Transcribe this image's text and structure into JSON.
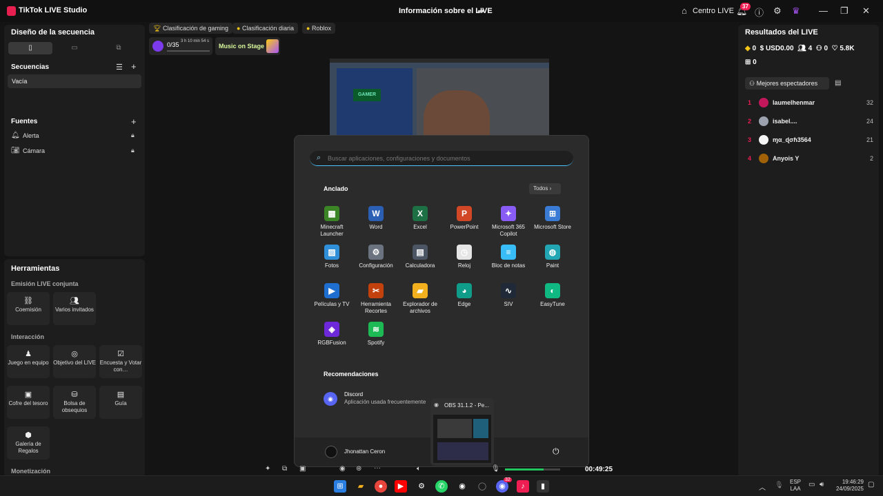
{
  "titlebar": {
    "app_name": "TikTok LIVE Studio",
    "center_title": "Información sobre el LIVE",
    "centro_label": "Centro LIVE",
    "notif_count": "37"
  },
  "left": {
    "design_title": "Diseño de la secuencia",
    "sequences_title": "Secuencias",
    "sequence_item": "Vacía",
    "sources_title": "Fuentes",
    "sources": [
      "Alerta",
      "Cámara"
    ],
    "tools_title": "Herramientas",
    "joint_title": "Emisión LIVE conjunta",
    "joint_tools": [
      "Coemisión",
      "Varios invitados"
    ],
    "interaction_title": "Interacción",
    "interaction_tools": [
      "Juego en equipo",
      "Objetivo del LIVE",
      "Encuesta y Votar con…",
      "Cofre del tesoro",
      "Bolsa de obsequios",
      "Guía",
      "Galería de Regalos"
    ],
    "monetization_title": "Monetización"
  },
  "center": {
    "chips": [
      "Clasificación de gaming",
      "Clasificación diaria",
      "Roblox"
    ],
    "goal_progress": "0/35",
    "goal_time": "3 h 10 min 54 s",
    "music_label": "Music on Stage",
    "timer": "00:49:25"
  },
  "start_menu": {
    "search_placeholder": "Buscar aplicaciones, configuraciones y documentos",
    "pinned_title": "Anclado",
    "all_button": "Todos",
    "apps": [
      {
        "label": "Minecraft Launcher",
        "color": "#3c8527"
      },
      {
        "label": "Word",
        "color": "#2b5fb4"
      },
      {
        "label": "Excel",
        "color": "#1d7044"
      },
      {
        "label": "PowerPoint",
        "color": "#d24726"
      },
      {
        "label": "Microsoft 365 Copilot",
        "color": "#8a5cf6"
      },
      {
        "label": "Microsoft Store",
        "color": "#3a7bd5"
      },
      {
        "label": "Fotos",
        "color": "#2f8fd8"
      },
      {
        "label": "Configuración",
        "color": "#6b7280"
      },
      {
        "label": "Calculadora",
        "color": "#4b5563"
      },
      {
        "label": "Reloj",
        "color": "#e5e5e5"
      },
      {
        "label": "Bloc de notas",
        "color": "#38bdf8"
      },
      {
        "label": "Paint",
        "color": "#22a6b3"
      },
      {
        "label": "Películas y TV",
        "color": "#1f6fd0"
      },
      {
        "label": "Herramienta Recortes",
        "color": "#c2410c"
      },
      {
        "label": "Explorador de archivos",
        "color": "#f2b01e"
      },
      {
        "label": "Edge",
        "color": "#0f9d8a"
      },
      {
        "label": "SIV",
        "color": "#1f2937"
      },
      {
        "label": "EasyTune",
        "color": "#10b981"
      },
      {
        "label": "RGBFusion",
        "color": "#6d28d9"
      },
      {
        "label": "Spotify",
        "color": "#1db954"
      }
    ],
    "recommended_title": "Recomendaciones",
    "rec_name": "Discord",
    "rec_sub": "Aplicación usada frecuentemente",
    "user_name": "Jhonattan Ceron",
    "obs_preview": "OBS 31.1.2 - Pe..."
  },
  "right": {
    "results_title": "Resultados del LIVE",
    "stats": [
      "0",
      "USD0.00",
      "4",
      "0",
      "5.8K"
    ],
    "diamonds": "0",
    "top_viewers_label": "Mejores espectadores",
    "viewers": [
      {
        "rank": "1",
        "name": "laumelhenmar",
        "score": "32"
      },
      {
        "rank": "2",
        "name": "isabel....",
        "score": "24"
      },
      {
        "rank": "3",
        "name": "ɱα_ɖσɦ3564",
        "score": "21"
      },
      {
        "rank": "4",
        "name": "Anyois Y",
        "score": "2"
      }
    ]
  },
  "taskbar": {
    "lang": "ESP",
    "lang2": "LAA",
    "time": "19:46:29",
    "date": "24/09/2025",
    "discord_badge": "32"
  }
}
